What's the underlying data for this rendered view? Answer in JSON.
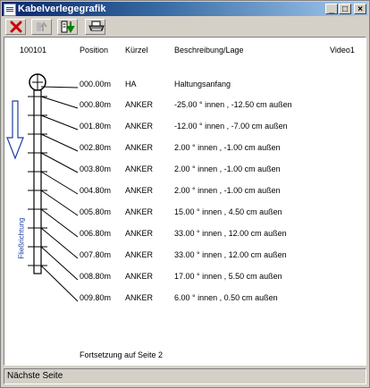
{
  "window": {
    "title": "Kabelverlegegrafik",
    "minimize": "_",
    "maximize": "□",
    "close": "×"
  },
  "header": {
    "id": "100101",
    "position": "Position",
    "kuerzel": "Kürzel",
    "beschreibung": "Beschreibung/Lage",
    "video": "Video1"
  },
  "rows": [
    {
      "position": "000.00m",
      "kuerzel": "HA",
      "beschreibung": "Haltungsanfang"
    },
    {
      "position": "000.80m",
      "kuerzel": "ANKER",
      "beschreibung": "-25.00 ° innen , -12.50 cm außen"
    },
    {
      "position": "001.80m",
      "kuerzel": "ANKER",
      "beschreibung": "-12.00 ° innen , -7.00 cm außen"
    },
    {
      "position": "002.80m",
      "kuerzel": "ANKER",
      "beschreibung": "2.00 ° innen , -1.00 cm außen"
    },
    {
      "position": "003.80m",
      "kuerzel": "ANKER",
      "beschreibung": "2.00 ° innen , -1.00 cm außen"
    },
    {
      "position": "004.80m",
      "kuerzel": "ANKER",
      "beschreibung": "2.00 ° innen , -1.00 cm außen"
    },
    {
      "position": "005.80m",
      "kuerzel": "ANKER",
      "beschreibung": "15.00 ° innen , 4.50 cm außen"
    },
    {
      "position": "006.80m",
      "kuerzel": "ANKER",
      "beschreibung": "33.00 ° innen , 12.00 cm außen"
    },
    {
      "position": "007.80m",
      "kuerzel": "ANKER",
      "beschreibung": "33.00 ° innen , 12.00 cm außen"
    },
    {
      "position": "008.80m",
      "kuerzel": "ANKER",
      "beschreibung": "17.00 ° innen , 5.50 cm außen"
    },
    {
      "position": "009.80m",
      "kuerzel": "ANKER",
      "beschreibung": "6.00 ° innen , 0.50 cm außen"
    }
  ],
  "flow_label": "Fließrichtung",
  "continuation": "Fortsetzung auf Seite 2",
  "status": "Nächste Seite",
  "colors": {
    "accent": "#0a246a",
    "flow": "#1f3fa0",
    "close": "#cc0000"
  }
}
